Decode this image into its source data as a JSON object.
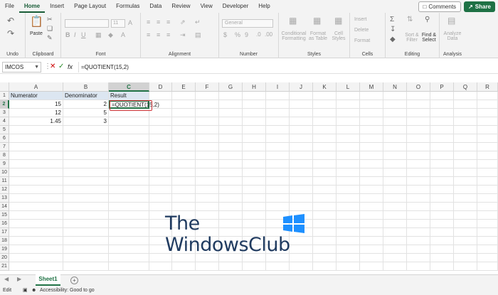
{
  "menu": {
    "tabs": [
      "File",
      "Home",
      "Insert",
      "Page Layout",
      "Formulas",
      "Data",
      "Review",
      "View",
      "Developer",
      "Help"
    ],
    "comments_label": "Comments",
    "share_label": "Share"
  },
  "ribbon": {
    "undo_label": "Undo",
    "clipboard_label": "Clipboard",
    "paste_label": "Paste",
    "font_label": "Font",
    "font_size": "11",
    "alignment_label": "Alignment",
    "number_label": "Number",
    "number_format": "General",
    "styles_label": "Styles",
    "conditional_formatting": "Conditional Formatting",
    "format_as_table": "Format as Table",
    "cell_styles": "Cell Styles",
    "cells_label": "Cells",
    "insert": "Insert",
    "delete": "Delete",
    "format": "Format",
    "editing_label": "Editing",
    "sort_filter": "Sort & Filter",
    "find_select": "Find & Select",
    "analysis_label": "Analysis",
    "analyze_data": "Analyze Data"
  },
  "formula_bar": {
    "name_box": "IMCOS",
    "formula": "=QUOTIENT(15,2)"
  },
  "grid": {
    "columns": [
      "A",
      "B",
      "C",
      "D",
      "E",
      "F",
      "G",
      "H",
      "I",
      "J",
      "K",
      "L",
      "M",
      "N",
      "O",
      "P",
      "Q",
      "R"
    ],
    "rows": [
      "1",
      "2",
      "3",
      "4",
      "5",
      "6",
      "7",
      "8",
      "9",
      "10",
      "11",
      "12",
      "13",
      "14",
      "15",
      "16",
      "17",
      "18",
      "19",
      "20",
      "21"
    ],
    "headers": [
      "Numerator",
      "Denominator",
      "Result"
    ],
    "data": [
      [
        "15",
        "2",
        "=QUOTIENT(15,2)"
      ],
      [
        "12",
        "5",
        ""
      ],
      [
        "1.45",
        "3",
        ""
      ]
    ]
  },
  "watermark": {
    "line1": "The",
    "line2": "WindowsClub",
    "color": "#1f3a5f",
    "logo_color": "#1e90ff"
  },
  "sheets": [
    "Sheet1"
  ],
  "status": {
    "mode": "Edit",
    "accessibility": "Accessibility: Good to go"
  },
  "colors": {
    "accent": "#217346",
    "share": "#1e7145",
    "highlight": "#d13438",
    "header_fill": "#dce6f1"
  }
}
